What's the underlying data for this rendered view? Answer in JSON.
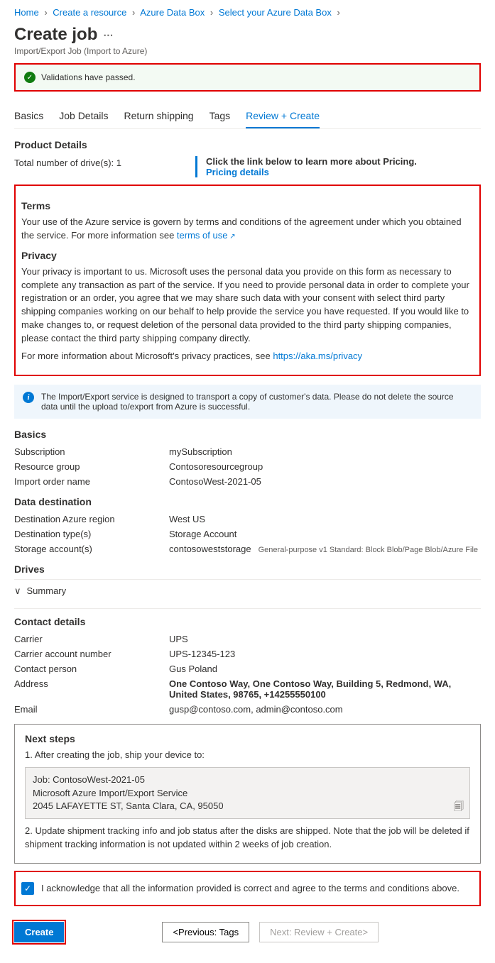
{
  "breadcrumb": [
    {
      "label": "Home"
    },
    {
      "label": "Create a resource"
    },
    {
      "label": "Azure Data Box"
    },
    {
      "label": "Select your Azure Data Box"
    }
  ],
  "page_title": "Create job",
  "page_subtitle": "Import/Export Job (Import to Azure)",
  "validation_message": "Validations have passed.",
  "tabs": [
    {
      "label": "Basics"
    },
    {
      "label": "Job Details"
    },
    {
      "label": "Return shipping"
    },
    {
      "label": "Tags"
    },
    {
      "label": "Review + Create",
      "active": true
    }
  ],
  "product_details": {
    "heading": "Product Details",
    "drives_label": "Total number of drive(s): 1",
    "pricing_prompt": "Click the link below to learn more about Pricing.",
    "pricing_link": "Pricing details"
  },
  "terms": {
    "heading": "Terms",
    "body_pre": "Your use of the Azure service is govern by terms and conditions of the agreement under which you obtained the service. For more information see ",
    "link": "terms of use"
  },
  "privacy": {
    "heading": "Privacy",
    "body1": "Your privacy is important to us. Microsoft uses the personal data you provide on this form as necessary to complete any transaction as part of the service. If you need to provide personal data in order to complete your registration or an order, you agree that we may share such data with your consent with select third party shipping companies working on our behalf to help provide the service you have requested. If you would like to make changes to, or request deletion of the personal data provided to the third party shipping companies, please contact the third party shipping company directly.",
    "body2_pre": "For more information about Microsoft's privacy practices, see ",
    "link": "https://aka.ms/privacy"
  },
  "info_banner": "The Import/Export service is designed to transport a copy of customer's data. Please do not delete the source data until the upload to/export from Azure is successful.",
  "basics": {
    "heading": "Basics",
    "rows": [
      {
        "label": "Subscription",
        "value": "mySubscription"
      },
      {
        "label": "Resource group",
        "value": "Contosoresourcegroup"
      },
      {
        "label": "Import order name",
        "value": "ContosoWest-2021-05"
      }
    ]
  },
  "data_destination": {
    "heading": "Data destination",
    "rows": [
      {
        "label": "Destination Azure region",
        "value": "West US"
      },
      {
        "label": "Destination type(s)",
        "value": "Storage Account"
      },
      {
        "label": "Storage account(s)",
        "value": "contosoweststorage",
        "meta": "General-purpose v1 Standard: Block Blob/Page Blob/Azure File"
      }
    ]
  },
  "drives": {
    "heading": "Drives",
    "summary": "Summary"
  },
  "contact": {
    "heading": "Contact details",
    "rows": [
      {
        "label": "Carrier",
        "value": "UPS"
      },
      {
        "label": "Carrier account number",
        "value": "UPS-12345-123"
      },
      {
        "label": "Contact person",
        "value": "Gus Poland"
      },
      {
        "label": "Address",
        "value": "One Contoso Way, One Contoso Way, Building 5, Redmond, WA, United States, 98765, +14255550100",
        "bold": true
      },
      {
        "label": "Email",
        "value": "gusp@contoso.com, admin@contoso.com"
      }
    ]
  },
  "next_steps": {
    "heading": "Next steps",
    "step1": "1. After creating the job, ship your device to:",
    "ship_line1": "Job: ContosoWest-2021-05",
    "ship_line2": "Microsoft Azure Import/Export Service",
    "ship_line3": "2045 LAFAYETTE ST, Santa Clara, CA, 95050",
    "step2": "2. Update shipment tracking info and job status after the disks are shipped. Note that the job will be deleted if shipment tracking information is not updated within 2 weeks of job creation."
  },
  "acknowledge": "I acknowledge that all the information provided is correct and agree to the terms and conditions above.",
  "footer": {
    "create": "Create",
    "prev": "<Previous: Tags",
    "next": "Next: Review + Create>"
  }
}
